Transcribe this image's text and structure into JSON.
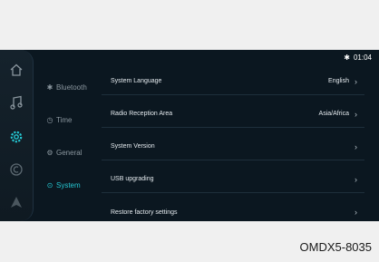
{
  "status": {
    "bluetooth_glyph": "✱",
    "time": "01:04"
  },
  "sidebar_icons": [
    {
      "name": "home-icon"
    },
    {
      "name": "music-icon"
    },
    {
      "name": "settings-icon"
    },
    {
      "name": "app-icon"
    },
    {
      "name": "navigation-icon"
    }
  ],
  "menu": {
    "items": [
      {
        "label": "Bluetooth",
        "glyph": "✱"
      },
      {
        "label": "Time",
        "glyph": "◷"
      },
      {
        "label": "General",
        "glyph": "⚙"
      },
      {
        "label": "System",
        "glyph": "⊙"
      }
    ],
    "active": "System"
  },
  "settings": [
    {
      "label": "System Language",
      "value": "English"
    },
    {
      "label": "Radio Reception Area",
      "value": "Asia/Africa"
    },
    {
      "label": "System Version",
      "value": ""
    },
    {
      "label": "USB upgrading",
      "value": ""
    },
    {
      "label": "Restore factory settings",
      "value": ""
    }
  ],
  "chevron": "›",
  "caption": "OMDX5-8035",
  "colors": {
    "accent": "#25c7d2",
    "background": "#0b1720"
  }
}
